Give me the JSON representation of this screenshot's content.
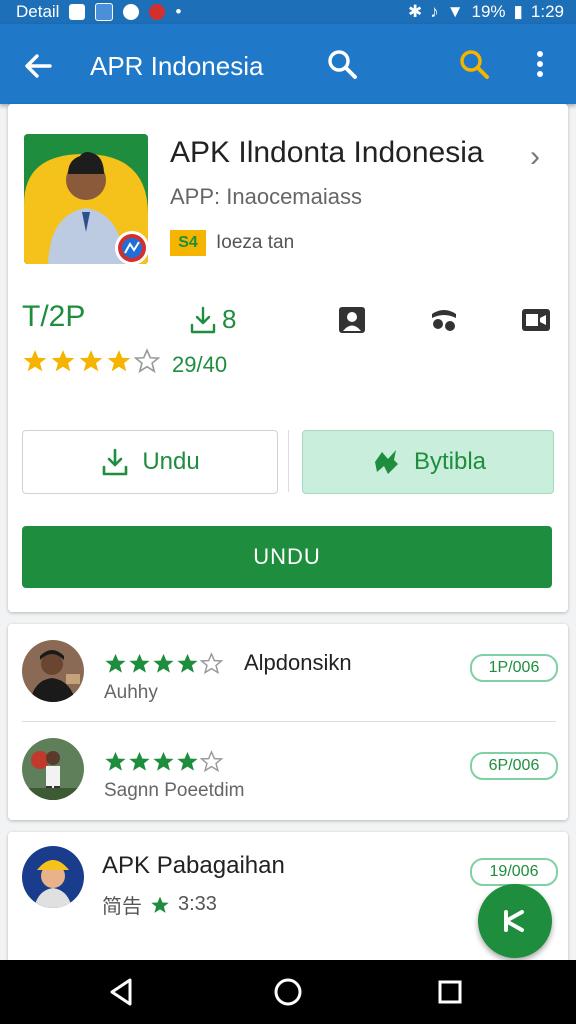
{
  "status_bar": {
    "left_text": "Detail",
    "battery": "19%",
    "time": "1:29"
  },
  "app_bar": {
    "title": "APR Indonesia"
  },
  "app": {
    "name": "APK Ilndonta Indonesia",
    "subtitle": "APP: Inaocemaiass",
    "badge_code": "S4",
    "badge_text": "Ioeza tan"
  },
  "stats": {
    "rank": "T/2P",
    "downloads": "8",
    "rating_count": "29/40",
    "rating": 4
  },
  "buttons": {
    "download_outline": "Undu",
    "secondary": "Bytibla",
    "primary": "UNDU"
  },
  "reviews": [
    {
      "name": "Alpdonsikn",
      "user": "Auhhy",
      "chip": "1P/006",
      "stars": 4
    },
    {
      "name": "",
      "user": "Sagnn Poeetdim",
      "chip": "6P/006",
      "stars": 4
    }
  ],
  "related": {
    "name": "APK Pabagaihan",
    "meta_prefix": "简告",
    "rating_value": "3:33",
    "chip": "19/006"
  },
  "colors": {
    "primary": "#1f78c8",
    "accent": "#1e8e3e",
    "star": "#f4b400"
  }
}
